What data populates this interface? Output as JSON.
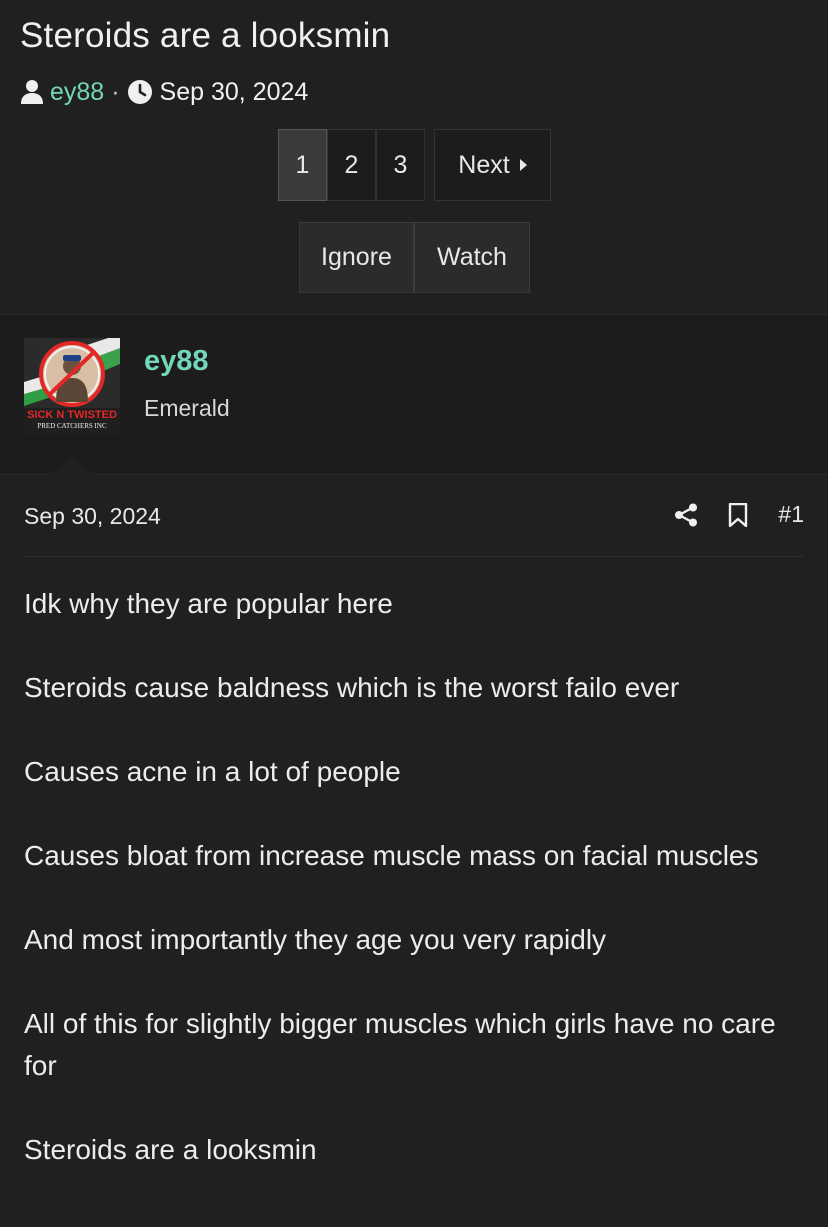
{
  "thread": {
    "title": "Steroids are a looksmin",
    "author": "ey88",
    "separator": "·",
    "date": "Sep 30, 2024"
  },
  "pager": {
    "pages": [
      "1",
      "2",
      "3"
    ],
    "current": "1",
    "next_label": "Next"
  },
  "actions": {
    "ignore_label": "Ignore",
    "watch_label": "Watch"
  },
  "post": {
    "user": {
      "name": "ey88",
      "title": "Emerald"
    },
    "avatar_caption": [
      "SICK N TWISTED",
      "PRED CATCHERS INC"
    ],
    "date": "Sep 30, 2024",
    "number": "#1",
    "paragraphs": [
      "Idk why they are popular here",
      "Steroids cause baldness which is the worst failo ever",
      "Causes acne in a lot of people",
      "Causes bloat from increase muscle mass on facial muscles",
      "And most importantly they age you very rapidly",
      "All of this for slightly bigger muscles which girls have no care for",
      "Steroids are a looksmin"
    ]
  },
  "colors": {
    "background": "#202020",
    "username": "#72d7b9",
    "text": "#e8e8e8"
  },
  "icons": [
    "user-icon",
    "clock-icon",
    "chevron-right-icon",
    "share-icon",
    "bookmark-icon"
  ]
}
